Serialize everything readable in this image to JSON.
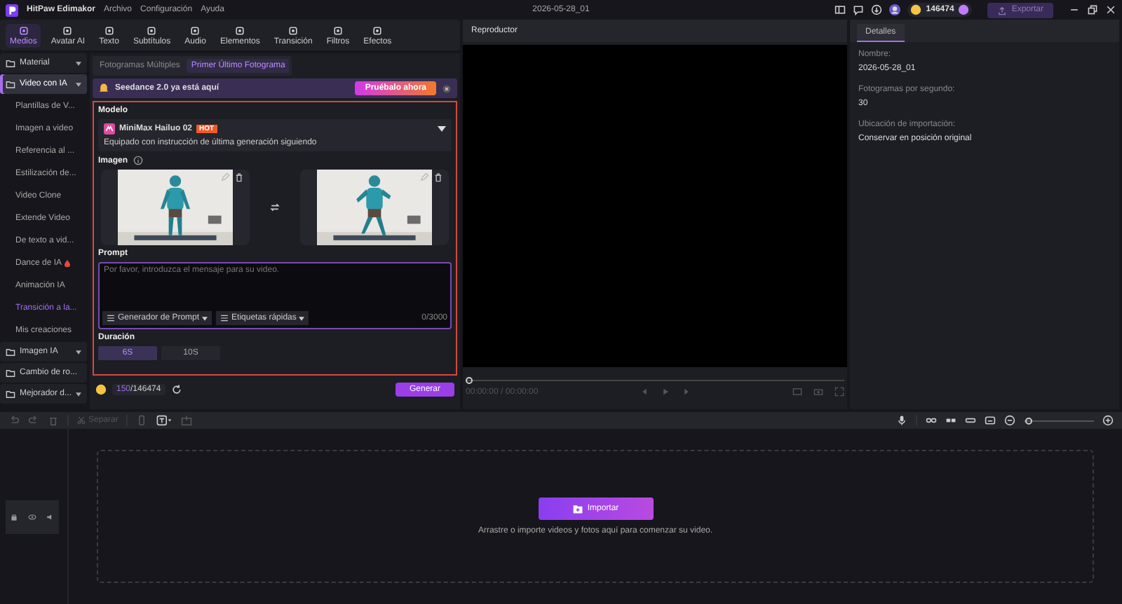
{
  "window": {
    "app_name": "HitPaw Edimakor",
    "menu": [
      "Archivo",
      "Configuración",
      "Ayuda"
    ],
    "project_title": "2026-05-28_01",
    "credits": "146474",
    "export_button": "Exportar"
  },
  "tool_tabs": [
    {
      "label": "Medios",
      "selected": true
    },
    {
      "label": "Avatar AI",
      "selected": false
    },
    {
      "label": "Texto",
      "selected": false
    },
    {
      "label": "Subtítulos",
      "selected": false
    },
    {
      "label": "Audio",
      "selected": false
    },
    {
      "label": "Elementos",
      "selected": false
    },
    {
      "label": "Transición",
      "selected": false
    },
    {
      "label": "Filtros",
      "selected": false
    },
    {
      "label": "Efectos",
      "selected": false
    }
  ],
  "sidebar": {
    "items": [
      {
        "label": "Material",
        "selected": false
      },
      {
        "label": "Video con IA",
        "selected": true,
        "children": [
          {
            "label": "Plantillas de V...",
            "selected": false,
            "hot": false
          },
          {
            "label": "Imagen a video",
            "selected": false,
            "hot": false
          },
          {
            "label": "Referencia al ...",
            "selected": false,
            "hot": false
          },
          {
            "label": "Estilización de...",
            "selected": false,
            "hot": false
          },
          {
            "label": "Video Clone",
            "selected": false,
            "hot": false
          },
          {
            "label": "Extende Video",
            "selected": false,
            "hot": false
          },
          {
            "label": "De texto a vid...",
            "selected": false,
            "hot": false
          },
          {
            "label": "Dance de IA",
            "selected": false,
            "hot": true
          },
          {
            "label": "Animación IA",
            "selected": false,
            "hot": false
          },
          {
            "label": "Transición a la...",
            "selected": true,
            "hot": false
          },
          {
            "label": "Mis creaciones",
            "selected": false,
            "hot": false
          }
        ]
      },
      {
        "label": "Imagen IA",
        "selected": false
      },
      {
        "label": "Cambio de ro...",
        "selected": false
      },
      {
        "label": "Mejorador d...",
        "selected": false
      }
    ]
  },
  "panel": {
    "sub_tabs": [
      {
        "label": "Fotogramas Múltiples",
        "selected": false
      },
      {
        "label": "Primer Último Fotograma",
        "selected": true
      }
    ],
    "banner": {
      "text": "Seedance 2.0 ya está aquí",
      "button": "Pruébalo ahora"
    },
    "model": {
      "heading": "Modelo",
      "name": "MiniMax Hailuo 02",
      "badge": "HOT",
      "description": "Equipado con instrucción de última generación siguiendo"
    },
    "image": {
      "heading": "Imagen"
    },
    "prompt": {
      "heading": "Prompt",
      "placeholder": "Por favor, introduzca el mensaje para su video.",
      "tools": [
        "Generador de Prompt",
        "Etiquetas rápidas"
      ],
      "count": "0/3000"
    },
    "duration": {
      "heading": "Duración",
      "options": [
        {
          "label": "6S",
          "selected": true
        },
        {
          "label": "10S",
          "selected": false
        }
      ]
    },
    "footer": {
      "cost": "150",
      "balance": "/146474",
      "button": "Generar"
    }
  },
  "player": {
    "title": "Reproductor",
    "time": "00:00:00 / 00:00:00"
  },
  "details": {
    "tab": {
      "label": "Detalles",
      "selected": true
    },
    "fields": [
      {
        "label": "Nombre:",
        "value": "2026-05-28_01"
      },
      {
        "label": "Fotogramas por segundo:",
        "value": "30"
      },
      {
        "label": "Ubicación de importación:",
        "value": "Conservar en posición original"
      }
    ]
  },
  "timeline": {
    "zoom": {
      "level": 0.02
    },
    "split_button": {
      "label": "Separar",
      "disabled": true
    },
    "import_button": "Importar",
    "hint": "Arrastre o importe videos y fotos aquí para comenzar su video."
  }
}
